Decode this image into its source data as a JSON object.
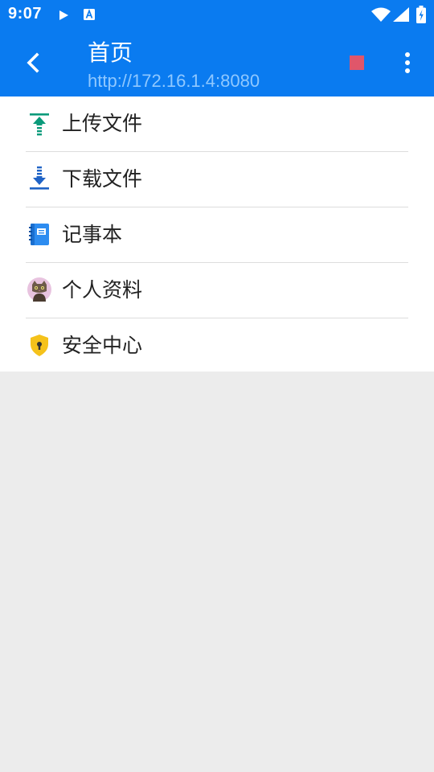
{
  "status_bar": {
    "time": "9:07",
    "icons": [
      "play-icon",
      "text-a-icon",
      "wifi-icon",
      "signal-icon",
      "battery-icon"
    ]
  },
  "app_bar": {
    "title": "首页",
    "subtitle": "http://172.16.1.4:8080",
    "background_color": "#0a7bf0",
    "back_icon": "chevron-left-icon",
    "stop_icon": "stop-square-icon",
    "stop_color": "#e0566a",
    "more_icon": "more-vertical-icon"
  },
  "menu": {
    "items": [
      {
        "label": "上传文件",
        "icon": "upload-icon",
        "icon_color": "#0a9a7a"
      },
      {
        "label": "下载文件",
        "icon": "download-icon",
        "icon_color": "#1f63c6"
      },
      {
        "label": "记事本",
        "icon": "notebook-icon",
        "icon_color": "#2d8cf0"
      },
      {
        "label": "个人资料",
        "icon": "cat-avatar-icon",
        "icon_color": "#e8c3df"
      },
      {
        "label": "安全中心",
        "icon": "shield-lock-icon",
        "icon_color": "#f5c21b"
      }
    ]
  }
}
